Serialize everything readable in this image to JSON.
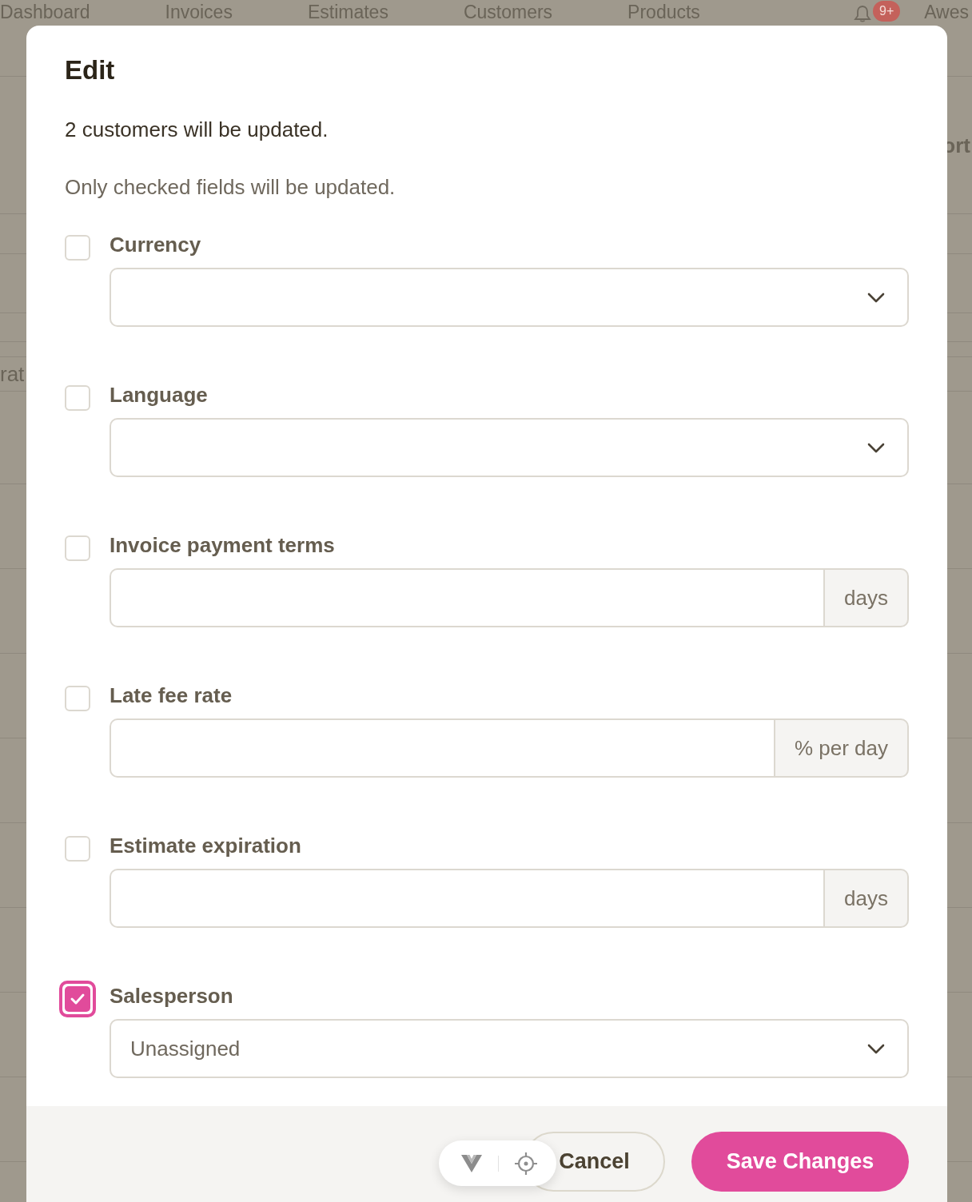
{
  "background": {
    "nav": [
      "Dashboard",
      "Invoices",
      "Estimates",
      "Customers",
      "Products"
    ],
    "notification_badge": "9+",
    "account_label": "Awes",
    "row_text_left": "rat",
    "row_text_right": "ort"
  },
  "modal": {
    "title": "Edit",
    "summary": "2 customers will be updated.",
    "hint": "Only checked fields will be updated.",
    "fields": [
      {
        "kind": "select",
        "label": "Currency",
        "checked": false
      },
      {
        "kind": "select",
        "label": "Language",
        "checked": false
      },
      {
        "kind": "input",
        "label": "Invoice payment terms",
        "checked": false,
        "suffix": "days"
      },
      {
        "kind": "input",
        "label": "Late fee rate",
        "checked": false,
        "suffix": "% per day"
      },
      {
        "kind": "input",
        "label": "Estimate expiration",
        "checked": false,
        "suffix": "days"
      },
      {
        "kind": "select",
        "label": "Salesperson",
        "checked": true,
        "value": "Unassigned"
      }
    ],
    "buttons": [
      {
        "kind": "secondary",
        "label": "Cancel"
      },
      {
        "kind": "primary",
        "label": "Save Changes"
      }
    ]
  }
}
